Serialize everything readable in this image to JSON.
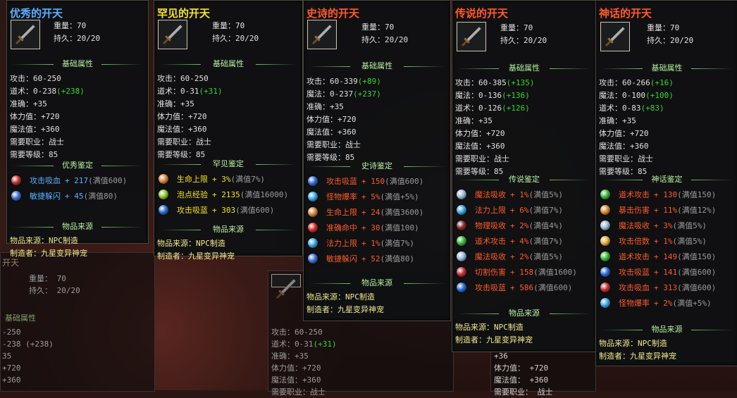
{
  "panels": [
    {
      "title": "优秀的开天",
      "title_color": "#5ab0ff",
      "weight_label": "重量：",
      "weight": "70",
      "dur_label": "持久：",
      "dur": "20/20",
      "base_title": "基础属性",
      "base": [
        [
          "攻击：",
          "60-250",
          ""
        ],
        [
          "道术：",
          "0-238",
          "(+238)"
        ],
        [
          "准确：",
          "+35",
          ""
        ],
        [
          "体力值：",
          "+720",
          ""
        ],
        [
          "魔法值：",
          "+360",
          ""
        ],
        [
          "需要职业：",
          "战士",
          ""
        ],
        [
          "需要等级：",
          "85",
          ""
        ]
      ],
      "appr_title": "优秀鉴定",
      "appr_color": "#5ab0ff",
      "appr": [
        {
          "icon": "red-rune-icon",
          "gem": "#c23030",
          "name": "攻击吸血",
          "val": "+ 217",
          "cap": "(满值600)"
        },
        {
          "icon": "blue-figure-icon",
          "gem": "#3b6fd6",
          "name": "敏捷躲闪",
          "val": "+ 45",
          "cap": "(满值80)"
        }
      ],
      "src_title": "物品来源",
      "src_label": "物品来源：",
      "src": "NPC制造",
      "maker_label": "制造者：",
      "maker": "九星变异神宠"
    },
    {
      "title": "罕见的开天",
      "title_color": "#f2e22a",
      "weight_label": "重量：",
      "weight": "70",
      "dur_label": "持久：",
      "dur": "20/20",
      "base_title": "基础属性",
      "base": [
        [
          "攻击：",
          "60-250",
          ""
        ],
        [
          "道术：",
          "0-31",
          "(+31)"
        ],
        [
          "准确：",
          "+35",
          ""
        ],
        [
          "体力值：",
          "+720",
          ""
        ],
        [
          "魔法值：",
          "+360",
          ""
        ],
        [
          "需要职业：",
          "战士",
          ""
        ],
        [
          "需要等级：",
          "85",
          ""
        ]
      ],
      "appr_title": "罕见鉴定",
      "appr_color": "#f2e22a",
      "appr": [
        {
          "icon": "heart-icon",
          "gem": "#d8843a",
          "name": "生命上限",
          "val": "+ 3%",
          "cap": "(满值7%)"
        },
        {
          "icon": "exp-icon",
          "gem": "#8ac82a",
          "name": "泡点经验",
          "val": "+ 2135",
          "cap": "(满值16000)"
        },
        {
          "icon": "blue-swirl-icon",
          "gem": "#2a6ad8",
          "name": "攻击吸蓝",
          "val": "+ 303",
          "cap": "(满值600)"
        }
      ],
      "src_title": "物品来源",
      "src_label": "物品来源：",
      "src": "NPC制造",
      "maker_label": "制造者：",
      "maker": "九星变异神宠"
    },
    {
      "title": "史诗的开天",
      "title_color": "#ff5b2b",
      "weight_label": "重量：",
      "weight": "70",
      "dur_label": "持久：",
      "dur": "20/20",
      "base_title": "基础属性",
      "base": [
        [
          "攻击：",
          "60-339",
          "(+89)"
        ],
        [
          "魔法：",
          "0-237",
          "(+237)"
        ],
        [
          "准确：",
          "+35",
          ""
        ],
        [
          "体力值：",
          "+720",
          ""
        ],
        [
          "魔法值：",
          "+360",
          ""
        ],
        [
          "需要职业：",
          "战士",
          ""
        ],
        [
          "需要等级：",
          "85",
          ""
        ]
      ],
      "appr_title": "史诗鉴定",
      "appr_color": "#ff5b2b",
      "appr": [
        {
          "icon": "blue-swirl-icon",
          "gem": "#2a6ad8",
          "name": "攻击吸蓝",
          "val": "+ 150",
          "cap": "(满值600)"
        },
        {
          "icon": "cyan-orb-icon",
          "gem": "#38a8e8",
          "name": "怪物爆率",
          "val": "+ 5%",
          "cap": "(满值+5%)"
        },
        {
          "icon": "heart-icon",
          "gem": "#d8843a",
          "name": "生命上限",
          "val": "+ 24",
          "cap": "(满值3600)"
        },
        {
          "icon": "cross-icon",
          "gem": "#d82a2a",
          "name": "准确命中",
          "val": "+ 30",
          "cap": "(满值100)"
        },
        {
          "icon": "cyan-orb-icon",
          "gem": "#38a8e8",
          "name": "法力上限",
          "val": "+ 1%",
          "cap": "(满值7%)"
        },
        {
          "icon": "blue-figure-icon",
          "gem": "#3b6fd6",
          "name": "敏捷躲闪",
          "val": "+ 52",
          "cap": "(满值80)"
        }
      ],
      "src_title": "物品来源",
      "src_label": "物品来源：",
      "src": "NPC制造",
      "maker_label": "制造者：",
      "maker": "九星变异神宠"
    },
    {
      "title": "传说的开天",
      "title_color": "#ff5b2b",
      "weight_label": "重量：",
      "weight": "70",
      "dur_label": "持久：",
      "dur": "20/20",
      "base_title": "基础属性",
      "base": [
        [
          "攻击：",
          "60-385",
          "(+135)"
        ],
        [
          "魔法：",
          "0-136",
          "(+136)"
        ],
        [
          "道术：",
          "0-126",
          "(+126)"
        ],
        [
          "准确：",
          "+35",
          ""
        ],
        [
          "体力值：",
          "+720",
          ""
        ],
        [
          "魔法值：",
          "+360",
          ""
        ],
        [
          "需要职业：",
          "战士",
          ""
        ],
        [
          "需要等级：",
          "85",
          ""
        ]
      ],
      "appr_title": "传说鉴定",
      "appr_color": "#ff5b2b",
      "appr": [
        {
          "icon": "sparkle-icon",
          "gem": "#9ab8d8",
          "name": "魔法吸收",
          "val": "+ 1%",
          "cap": "(满值5%)"
        },
        {
          "icon": "cyan-orb-icon",
          "gem": "#38a8e8",
          "name": "法力上限",
          "val": "+ 6%",
          "cap": "(满值7%)"
        },
        {
          "icon": "red-rune-icon",
          "gem": "#8a2a2a",
          "name": "物理吸收",
          "val": "+ 2%",
          "cap": "(满值4%)"
        },
        {
          "icon": "green-figure-icon",
          "gem": "#38b838",
          "name": "道术攻击",
          "val": "+ 4%",
          "cap": "(满值7%)"
        },
        {
          "icon": "sparkle-icon",
          "gem": "#9ab8d8",
          "name": "魔法吸收",
          "val": "+ 2%",
          "cap": "(满值5%)"
        },
        {
          "icon": "red-rune-icon",
          "gem": "#c23030",
          "name": "切割伤害",
          "val": "+ 158",
          "cap": "(满值1600)"
        },
        {
          "icon": "blue-swirl-icon",
          "gem": "#2a6ad8",
          "name": "攻击吸蓝",
          "val": "+ 586",
          "cap": "(满值600)"
        }
      ],
      "src_title": "物品来源",
      "src_label": "物品来源：",
      "src": "NPC制造",
      "maker_label": "制造者：",
      "maker": "九星变异神宠"
    },
    {
      "title": "神话的开天",
      "title_color": "#ff5b2b",
      "weight_label": "重量：",
      "weight": "70",
      "dur_label": "持久：",
      "dur": "20/20",
      "base_title": "基础属性",
      "base": [
        [
          "攻击：",
          "60-266",
          "(+16)"
        ],
        [
          "魔法：",
          "0-100",
          "(+100)"
        ],
        [
          "道术：",
          "0-83",
          "(+83)"
        ],
        [
          "准确：",
          "+35",
          ""
        ],
        [
          "体力值：",
          "+720",
          ""
        ],
        [
          "魔法值：",
          "+360",
          ""
        ],
        [
          "需要职业：",
          "战士",
          ""
        ],
        [
          "需要等级：",
          "85",
          ""
        ]
      ],
      "appr_title": "神话鉴定",
      "appr_color": "#ff5b2b",
      "appr": [
        {
          "icon": "green-figure-icon",
          "gem": "#38b838",
          "name": "道术攻击",
          "val": "+ 130",
          "cap": "(满值150)"
        },
        {
          "icon": "claw-icon",
          "gem": "#d88a2a",
          "name": "暴击伤害",
          "val": "+ 11%",
          "cap": "(满值12%)"
        },
        {
          "icon": "sparkle-icon",
          "gem": "#9ab8d8",
          "name": "魔法吸收",
          "val": "+ 3%",
          "cap": "(满值5%)"
        },
        {
          "icon": "fist-icon",
          "gem": "#e8a83a",
          "name": "攻击倍数",
          "val": "+ 1%",
          "cap": "(满值5%)"
        },
        {
          "icon": "green-figure-icon",
          "gem": "#38b838",
          "name": "道术攻击",
          "val": "+ 149",
          "cap": "(满值150)"
        },
        {
          "icon": "blue-swirl-icon",
          "gem": "#2a6ad8",
          "name": "攻击吸蓝",
          "val": "+ 141",
          "cap": "(满值600)"
        },
        {
          "icon": "red-rune-icon",
          "gem": "#c23030",
          "name": "攻击吸血",
          "val": "+ 313",
          "cap": "(满值600)"
        },
        {
          "icon": "cyan-orb-icon",
          "gem": "#38a8e8",
          "name": "怪物爆率",
          "val": "+ 2%",
          "cap": "(满值+5%)"
        }
      ],
      "src_title": "物品来源",
      "src_label": "物品来源：",
      "src": "NPC制造",
      "maker_label": "制造者：",
      "maker": "九星变异神宠"
    }
  ],
  "ghost_left": {
    "title": "开天",
    "weight": "重量： 70",
    "dur": "持久： 20/20",
    "base_title": "基础属性",
    "lines": [
      "-250",
      "-238 (+238)",
      "35",
      "+720",
      "+360"
    ]
  },
  "ghost_mid": {
    "lines": [
      [
        "攻击：",
        "60-250",
        ""
      ],
      [
        "道术：",
        "0-31",
        "(+31)"
      ],
      [
        "准确：",
        "+35",
        ""
      ],
      [
        "体力值：",
        "+720",
        ""
      ],
      [
        "魔法值：",
        "+360",
        ""
      ],
      [
        "需要职业：",
        "战士",
        ""
      ]
    ]
  },
  "ghost_right": {
    "lines": [
      "+36",
      "体力值： +720",
      "魔法值： +360",
      "需要职业： 战士"
    ]
  }
}
